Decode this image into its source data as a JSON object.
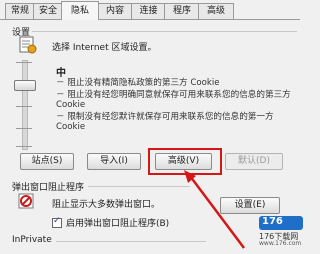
{
  "tabs": [
    {
      "label": "常规",
      "active": false
    },
    {
      "label": "安全",
      "active": false
    },
    {
      "label": "隐私",
      "active": true
    },
    {
      "label": "内容",
      "active": false
    },
    {
      "label": "连接",
      "active": false
    },
    {
      "label": "程序",
      "active": false
    },
    {
      "label": "高级",
      "active": false
    }
  ],
  "settings": {
    "group_label": "设置",
    "instruction": "选择 Internet 区域设置。",
    "level_label": "中",
    "descriptions": [
      "－ 阻止没有精简隐私政策的第三方 Cookie",
      "－ 阻止没有经您明确同意就保存可用来联系您的信息的第三方 Cookie",
      "－ 限制没有经您默许就保存可用来联系您的信息的第一方 Cookie"
    ],
    "buttons": {
      "sites": "站点(S)",
      "import": "导入(I)",
      "advanced": "高级(V)",
      "default": "默认(D)"
    }
  },
  "popup": {
    "group_label": "弹出窗口阻止程序",
    "block_label": "阻止显示大多数弹出窗口。",
    "settings_button": "设置(E)",
    "enable_label": "启用弹出窗口阻止程序(B)",
    "enable_checked": true
  },
  "inprivate": {
    "group_label": "InPrivate"
  },
  "watermark": {
    "logo_text": "176",
    "site_text": "176下载网",
    "url_text": "www.176.com"
  },
  "colors": {
    "annotation_red": "#d41818"
  }
}
